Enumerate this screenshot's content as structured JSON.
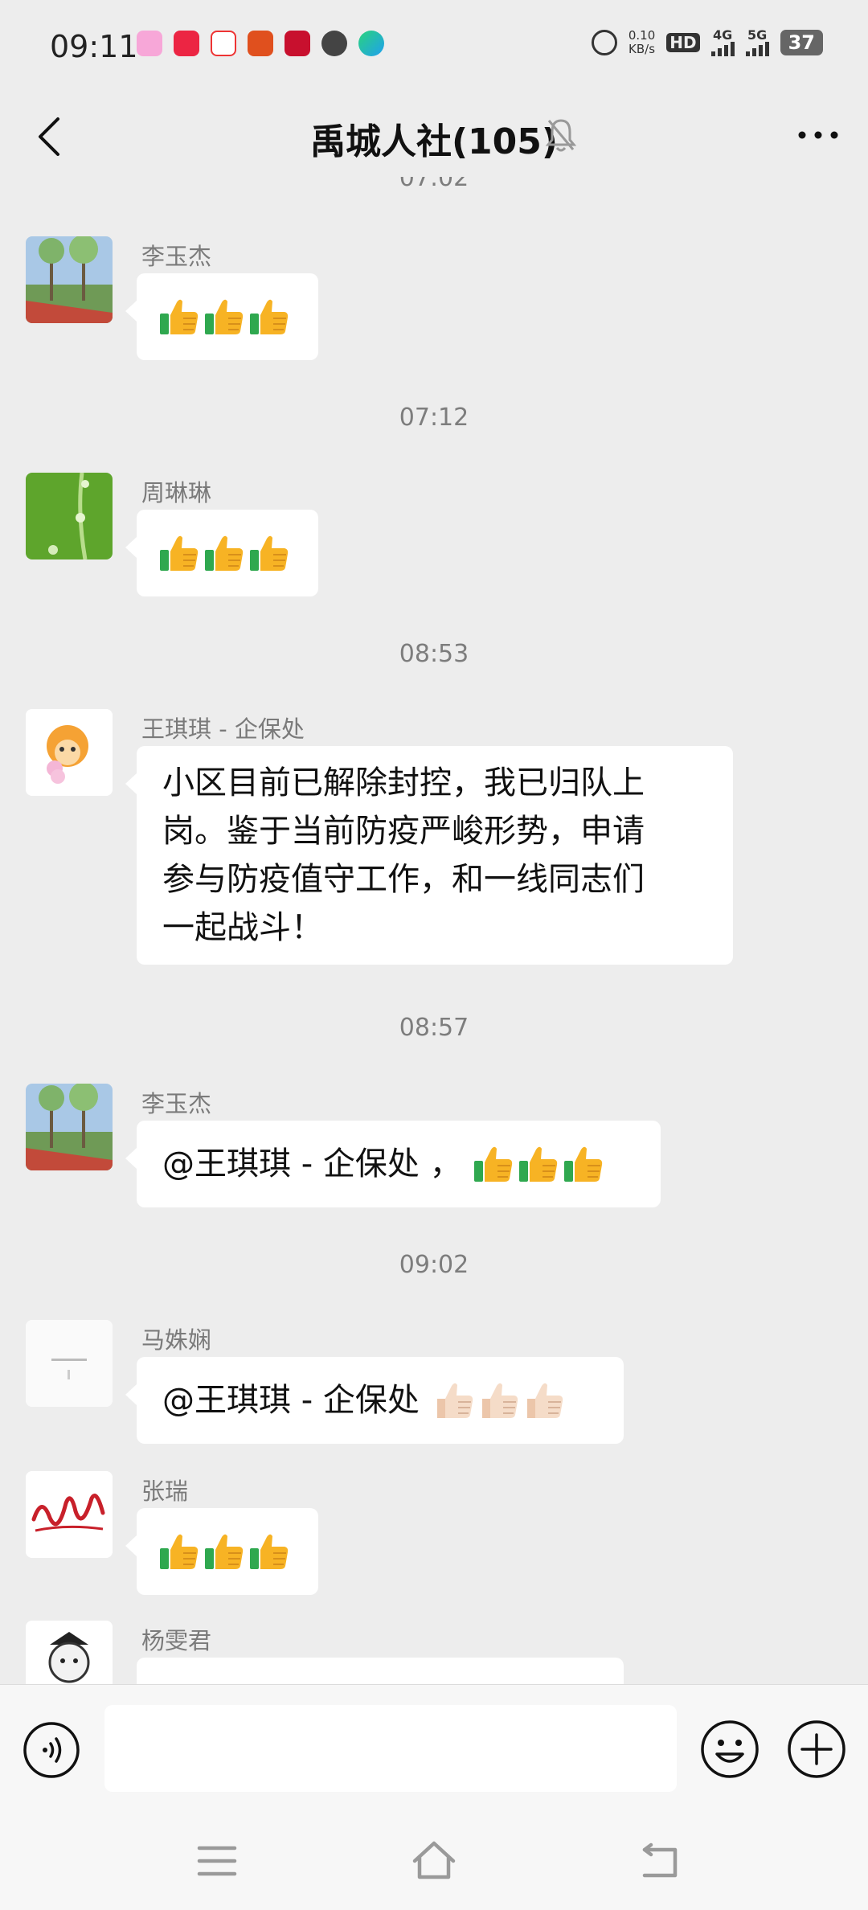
{
  "status_bar": {
    "time": "09:11",
    "net_speed_value": "0.10",
    "net_speed_unit": "KB/s",
    "hd": "HD",
    "signal1": "4G",
    "signal2": "5G",
    "battery": "37"
  },
  "header": {
    "title": "禹城人社(105)"
  },
  "messages": {
    "partial_time": "07:02",
    "m1": {
      "sender": "李玉杰"
    },
    "t1": "07:12",
    "m2": {
      "sender": "周琳琳"
    },
    "t2": "08:53",
    "m3": {
      "sender": "王琪琪 - 企保处",
      "lines": [
        "小区目前已解除封控，我已归队上",
        "岗。鉴于当前防疫严峻形势，申请",
        "参与防疫值守工作，和一线同志们",
        "一起战斗！"
      ]
    },
    "t3": "08:57",
    "m4": {
      "sender": "李玉杰",
      "text": "@王琪琪 - 企保处 ，"
    },
    "t4": "09:02",
    "m5": {
      "sender": "马姝娴",
      "text": "@王琪琪 - 企保处"
    },
    "m6": {
      "sender": "张瑞"
    },
    "m7": {
      "sender": "杨雯君"
    }
  },
  "input": {
    "placeholder": ""
  },
  "colors": {
    "background": "#ededed",
    "bubble": "#ffffff",
    "timestamp": "#7d7d7d",
    "thumb_yellow": "#f7b324",
    "thumb_green": "#2fa84f",
    "thumb_light": "#f5dcc8"
  }
}
